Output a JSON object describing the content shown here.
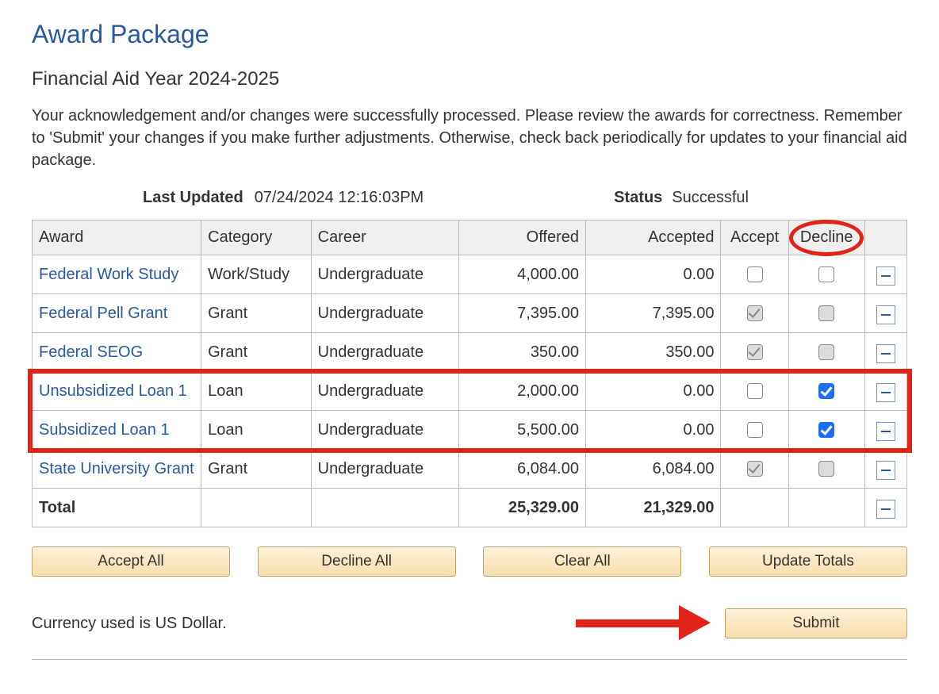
{
  "title": "Award Package",
  "subtitle": "Financial Aid Year 2024-2025",
  "intro": "Your acknowledgement and/or changes were successfully processed.  Please review the awards for correctness.  Remember to 'Submit' your changes if you make further adjustments. Otherwise, check back periodically for updates to your financial aid package.",
  "last_updated_label": "Last Updated",
  "last_updated_value": "07/24/2024 12:16:03PM",
  "status_label": "Status",
  "status_value": "Successful",
  "columns": {
    "award": "Award",
    "category": "Category",
    "career": "Career",
    "offered": "Offered",
    "accepted": "Accepted",
    "accept": "Accept",
    "decline": "Decline"
  },
  "rows": [
    {
      "award": "Federal Work Study",
      "category": "Work/Study",
      "career": "Undergraduate",
      "offered": "4,000.00",
      "accepted": "0.00",
      "accept": {
        "checked": false,
        "disabled": false
      },
      "decline": {
        "checked": false,
        "disabled": false,
        "style": "black"
      }
    },
    {
      "award": "Federal Pell Grant",
      "category": "Grant",
      "career": "Undergraduate",
      "offered": "7,395.00",
      "accepted": "7,395.00",
      "accept": {
        "checked": true,
        "disabled": true
      },
      "decline": {
        "checked": false,
        "disabled": true
      }
    },
    {
      "award": "Federal SEOG",
      "category": "Grant",
      "career": "Undergraduate",
      "offered": "350.00",
      "accepted": "350.00",
      "accept": {
        "checked": true,
        "disabled": true
      },
      "decline": {
        "checked": false,
        "disabled": true
      }
    },
    {
      "award": "Unsubsidized Loan 1",
      "category": "Loan",
      "career": "Undergraduate",
      "offered": "2,000.00",
      "accepted": "0.00",
      "accept": {
        "checked": false,
        "disabled": false
      },
      "decline": {
        "checked": true,
        "disabled": false,
        "style": "blue"
      }
    },
    {
      "award": "Subsidized Loan 1",
      "category": "Loan",
      "career": "Undergraduate",
      "offered": "5,500.00",
      "accepted": "0.00",
      "accept": {
        "checked": false,
        "disabled": false
      },
      "decline": {
        "checked": true,
        "disabled": false,
        "style": "blue"
      }
    },
    {
      "award": "State University Grant",
      "category": "Grant",
      "career": "Undergraduate",
      "offered": "6,084.00",
      "accepted": "6,084.00",
      "accept": {
        "checked": true,
        "disabled": true
      },
      "decline": {
        "checked": false,
        "disabled": true
      }
    }
  ],
  "total": {
    "label": "Total",
    "offered": "25,329.00",
    "accepted": "21,329.00"
  },
  "buttons": {
    "accept_all": "Accept All",
    "decline_all": "Decline All",
    "clear_all": "Clear All",
    "update_totals": "Update Totals",
    "submit": "Submit"
  },
  "currency_note": "Currency used is US Dollar."
}
